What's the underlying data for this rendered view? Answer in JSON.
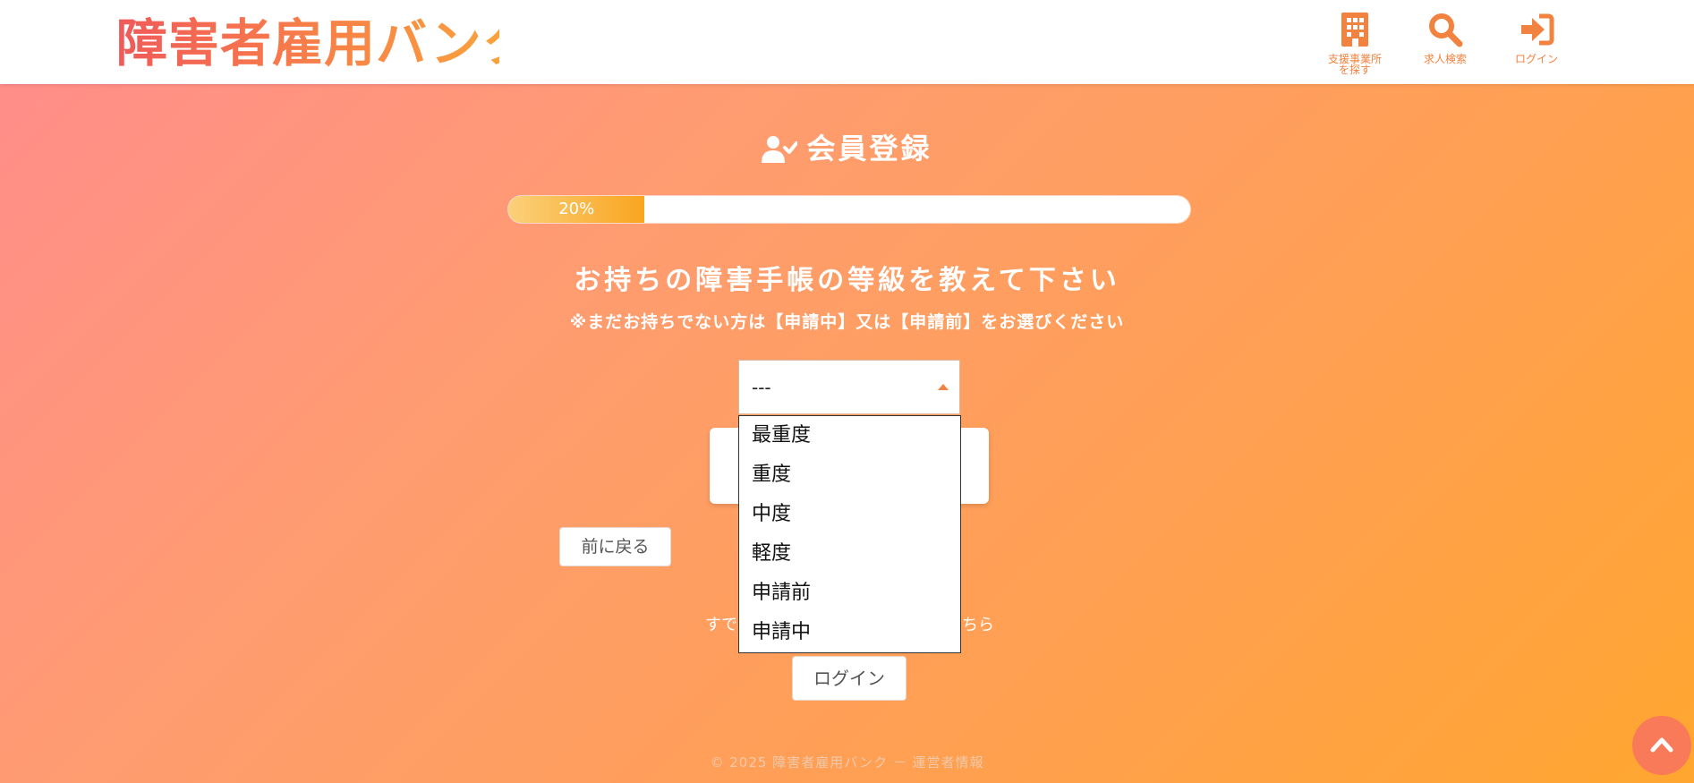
{
  "header": {
    "logo": "障害者雇用バンク",
    "nav": [
      {
        "label": "支援事業所\nを探す",
        "icon": "building-icon"
      },
      {
        "label": "求人検索",
        "icon": "search-icon"
      },
      {
        "label": "ログイン",
        "icon": "sign-in-icon"
      }
    ]
  },
  "page": {
    "title": "会員登録",
    "title_icon": "user-check-icon",
    "progress_label": "20%",
    "progress_value": 20,
    "question": "お持ちの障害手帳の等級を教えて下さい",
    "note": "※まだお持ちでない方は【申請中】又は【申請前】をお選びください"
  },
  "select": {
    "value": "---",
    "options": [
      "最重度",
      "重度",
      "中度",
      "軽度",
      "申請前",
      "申請中"
    ]
  },
  "buttons": {
    "back": "前に戻る",
    "login": "ログイン"
  },
  "already": {
    "left_fragment": "すで",
    "right_fragment": "ちら"
  },
  "footer": {
    "text": "© 2025 障害者雇用バンク － 運営者情報"
  },
  "colors": {
    "accent": "#f2823f",
    "progress_fill": "#f9a520",
    "scroll_button": "#f97a58"
  }
}
